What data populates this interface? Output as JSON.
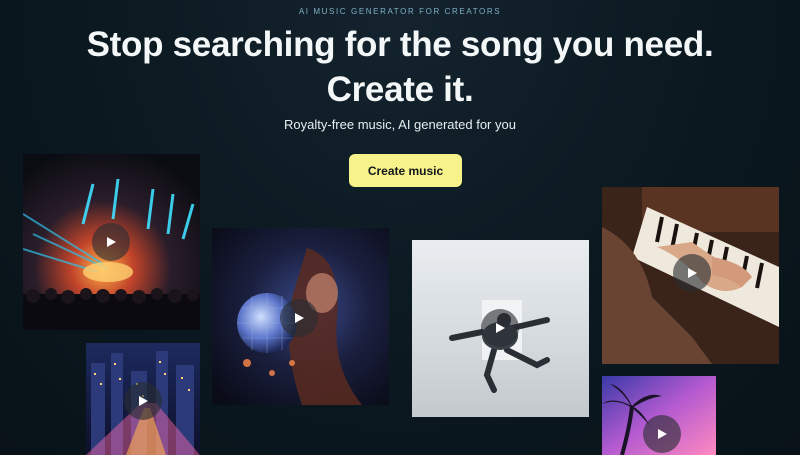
{
  "hero": {
    "eyebrow": "AI MUSIC GENERATOR FOR CREATORS",
    "headline_line1": "Stop searching for the song you need.",
    "headline_line2": "Create it.",
    "subtitle": "Royalty-free music, AI generated for you",
    "cta_label": "Create music"
  },
  "colors": {
    "background": "#0c1a22",
    "cta": "#f7f28a",
    "eyebrow": "#7fb0c4"
  },
  "gallery": [
    {
      "name": "concert-stage",
      "icon": "play-icon"
    },
    {
      "name": "city-night",
      "icon": "play-icon"
    },
    {
      "name": "disco-ball",
      "icon": "play-icon"
    },
    {
      "name": "dancer",
      "icon": "play-icon"
    },
    {
      "name": "piano",
      "icon": "play-icon"
    },
    {
      "name": "palm-sunset",
      "icon": "play-icon"
    }
  ]
}
